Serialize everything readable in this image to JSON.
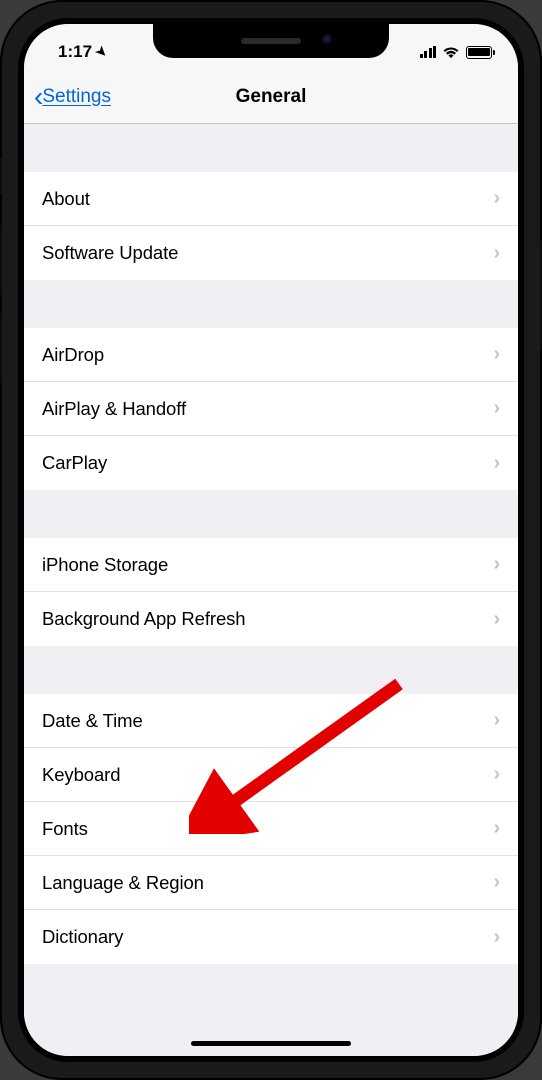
{
  "statusbar": {
    "time": "1:17"
  },
  "navbar": {
    "back_label": "Settings",
    "title": "General"
  },
  "groups": [
    {
      "items": [
        {
          "id": "about",
          "label": "About"
        },
        {
          "id": "software-update",
          "label": "Software Update"
        }
      ]
    },
    {
      "items": [
        {
          "id": "airdrop",
          "label": "AirDrop"
        },
        {
          "id": "airplay-handoff",
          "label": "AirPlay & Handoff"
        },
        {
          "id": "carplay",
          "label": "CarPlay"
        }
      ]
    },
    {
      "items": [
        {
          "id": "iphone-storage",
          "label": "iPhone Storage"
        },
        {
          "id": "background-app-refresh",
          "label": "Background App Refresh"
        }
      ]
    },
    {
      "items": [
        {
          "id": "date-time",
          "label": "Date & Time"
        },
        {
          "id": "keyboard",
          "label": "Keyboard"
        },
        {
          "id": "fonts",
          "label": "Fonts"
        },
        {
          "id": "language-region",
          "label": "Language & Region"
        },
        {
          "id": "dictionary",
          "label": "Dictionary"
        }
      ]
    }
  ],
  "annotation": {
    "target": "date-time",
    "color": "#e30000"
  }
}
